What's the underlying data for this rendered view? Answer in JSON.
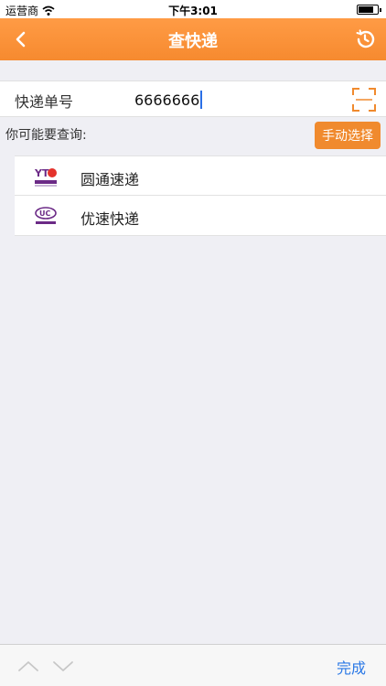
{
  "status_bar": {
    "carrier": "运营商",
    "time": "下午3:01"
  },
  "nav": {
    "title": "查快递",
    "back_icon": "chevron-left-icon",
    "history_icon": "history-icon",
    "color": "#f68a2f"
  },
  "tracking": {
    "label": "快递单号",
    "value": "6666666",
    "scan_icon": "scan-frame-icon"
  },
  "hint": {
    "text": "你可能要查询:",
    "manual_button": "手动选择"
  },
  "couriers": [
    {
      "name": "圆通速递",
      "logo": "yto-logo",
      "logo_caption": "圆通速递"
    },
    {
      "name": "优速快递",
      "logo": "uc-logo",
      "logo_caption": "优速快递"
    }
  ],
  "keyboard_toolbar": {
    "done_label": "完成",
    "up_icon": "chevron-up-icon",
    "down_icon": "chevron-down-icon"
  }
}
